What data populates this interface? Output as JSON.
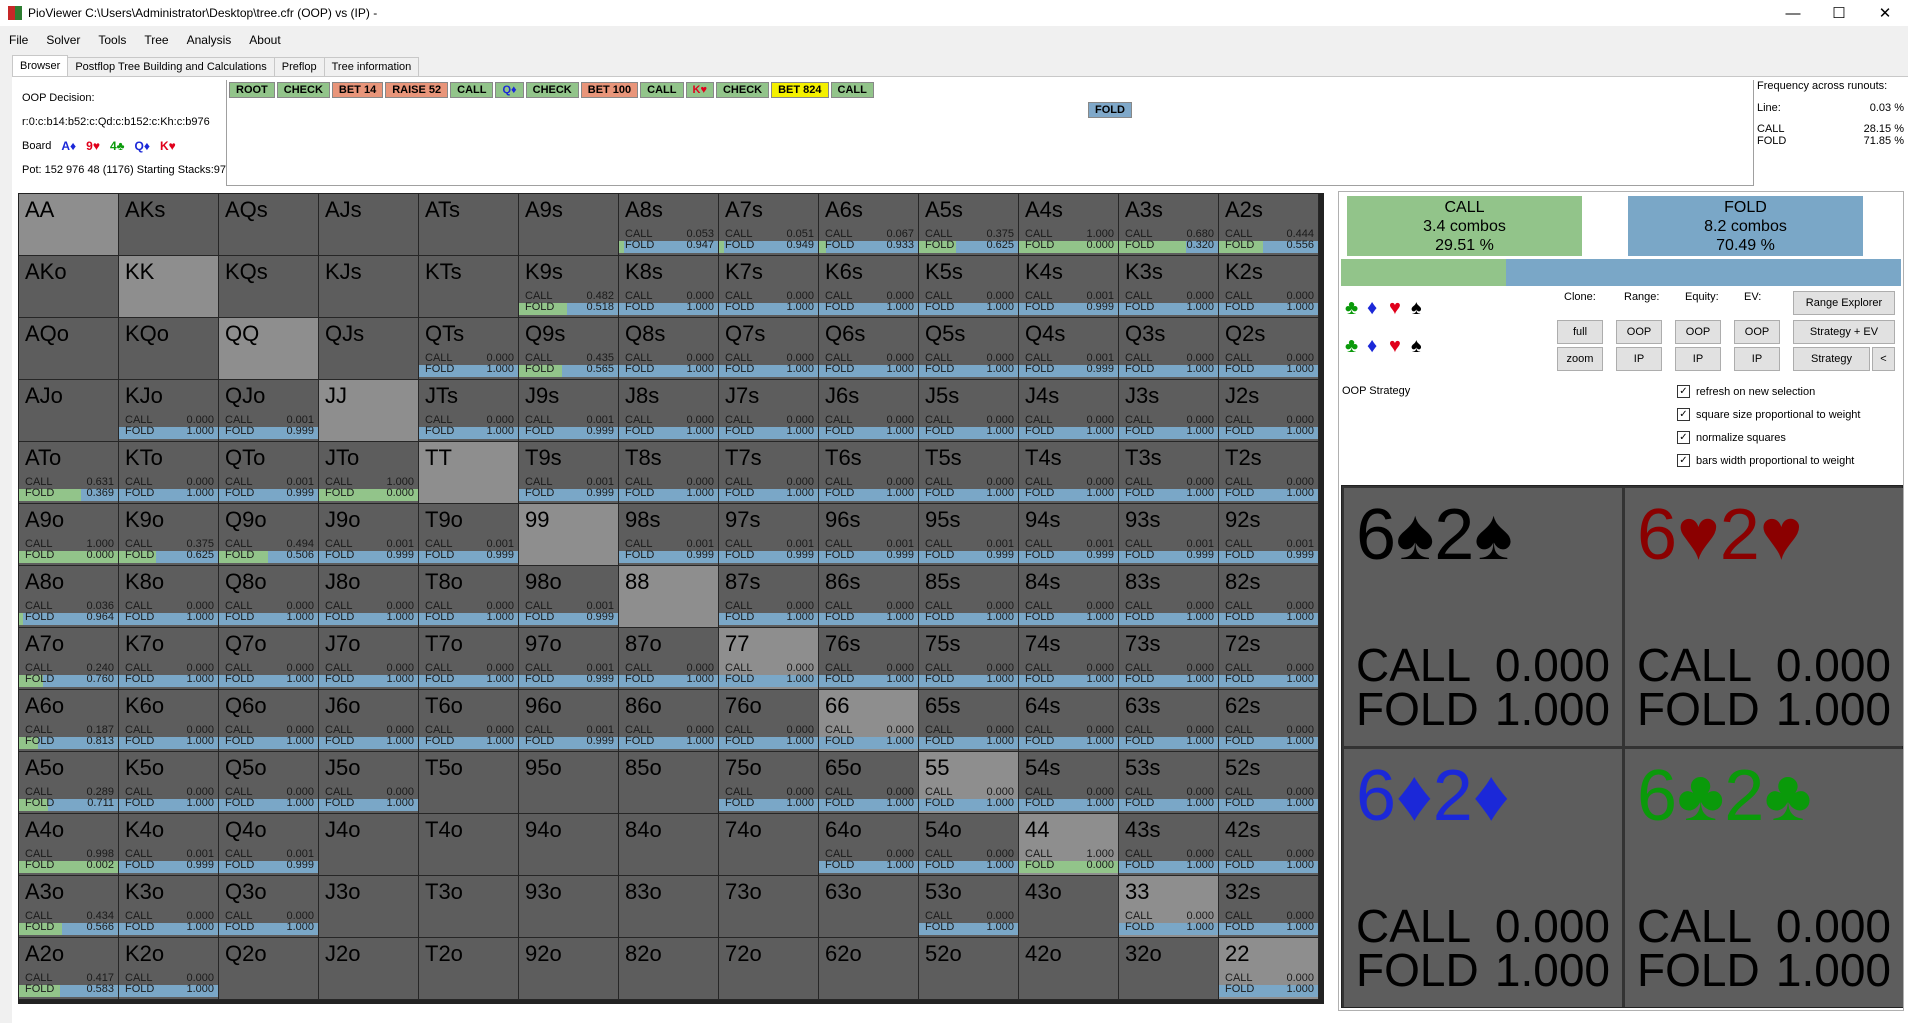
{
  "window": {
    "title": "PioViewer C:\\Users\\Administrator\\Desktop\\tree.cfr (OOP) vs (IP) -",
    "min": "—",
    "max": "☐",
    "close": "✕"
  },
  "menu": [
    "File",
    "Solver",
    "Tools",
    "Tree",
    "Analysis",
    "About"
  ],
  "tabs": [
    "Browser",
    "Postflop Tree Building and Calculations",
    "Preflop",
    "Tree information"
  ],
  "decision": {
    "title": "OOP Decision:",
    "line": "r:0:c:b14:b52:c:Qd:c:b152:c:Kh:c:b976",
    "board_label": "Board",
    "board": [
      {
        "t": "A♦",
        "c": "#1b28d8"
      },
      {
        "t": "9♥",
        "c": "#e0001b"
      },
      {
        "t": "4♣",
        "c": "#0a9a0a"
      },
      {
        "t": "Q♦",
        "c": "#1b28d8"
      },
      {
        "t": "K♥",
        "c": "#e0001b"
      }
    ],
    "pot": "Pot: 152 976 48 (1176) Starting Stacks:97"
  },
  "line": [
    {
      "t": "ROOT",
      "bg": "#92c48a"
    },
    {
      "t": "CHECK",
      "bg": "#92c48a"
    },
    {
      "t": "BET 14",
      "bg": "#e8957a"
    },
    {
      "t": "RAISE 52",
      "bg": "#e8957a"
    },
    {
      "t": "CALL",
      "bg": "#92c48a"
    },
    {
      "t": "Q♦",
      "bg": "#92c48a",
      "fg": "#1b28d8"
    },
    {
      "t": "CHECK",
      "bg": "#92c48a"
    },
    {
      "t": "BET 100",
      "bg": "#e8957a"
    },
    {
      "t": "CALL",
      "bg": "#92c48a"
    },
    {
      "t": "K♥",
      "bg": "#92c48a",
      "fg": "#e0001b"
    },
    {
      "t": "CHECK",
      "bg": "#92c48a"
    },
    {
      "t": "BET 824",
      "bg": "#f4f000"
    },
    {
      "t": "CALL",
      "bg": "#92c48a"
    }
  ],
  "fold_node": "FOLD",
  "frequency": {
    "title": "Frequency across runouts:",
    "line_label": "Line:",
    "line_val": "0.03 %",
    "call_label": "CALL",
    "call_val": "28.15 %",
    "fold_label": "FOLD",
    "fold_val": "71.85 %"
  },
  "summary": {
    "call": {
      "label": "CALL",
      "combos": "3.4 combos",
      "pct": "29.51 %",
      "frac": 0.2951,
      "color": "#92c48a"
    },
    "fold": {
      "label": "FOLD",
      "combos": "8.2 combos",
      "pct": "70.49 %",
      "color": "#7aa7c7"
    }
  },
  "clone": {
    "clone": "Clone:",
    "range": "Range:",
    "equity": "Equity:",
    "ev": "EV:"
  },
  "buttons": {
    "full": "full",
    "zoom": "zoom",
    "oop1": "OOP",
    "ip1": "IP",
    "oop2": "OOP",
    "ip2": "IP",
    "oop3": "OOP",
    "ip3": "IP",
    "range_explorer": "Range Explorer",
    "strategy_ev": "Strategy + EV",
    "strategy": "Strategy",
    "back": "<"
  },
  "suits": [
    {
      "t": "♣",
      "c": "#0a9a0a"
    },
    {
      "t": "♦",
      "c": "#1b28d8"
    },
    {
      "t": "♥",
      "c": "#e0001b"
    },
    {
      "t": "♠",
      "c": "#000"
    }
  ],
  "strategy_label": "OOP Strategy",
  "checks": [
    "refresh on new selection",
    "square size proportional to weight",
    "normalize squares",
    "bars width proportional to weight"
  ],
  "check_mark": "✓",
  "combos": [
    {
      "name": "6♠2♠",
      "color": "#000",
      "call": "0.000",
      "fold": "1.000"
    },
    {
      "name": "6♥2♥",
      "color": "#8b0000",
      "call": "0.000",
      "fold": "1.000"
    },
    {
      "name": "6♦2♦",
      "color": "#1b28d8",
      "call": "0.000",
      "fold": "1.000"
    },
    {
      "name": "6♣2♣",
      "color": "#0a9a0a",
      "call": "0.000",
      "fold": "1.000"
    }
  ],
  "combo_labels": {
    "call": "CALL",
    "fold": "FOLD"
  },
  "grid_labels": {
    "call": "CALL",
    "fold": "FOLD"
  },
  "grid": [
    [
      [
        "AA"
      ],
      [
        "AKs"
      ],
      [
        "AQs"
      ],
      [
        "AJs"
      ],
      [
        "ATs"
      ],
      [
        "A9s"
      ],
      [
        "A8s",
        "0.053",
        "0.947"
      ],
      [
        "A7s",
        "0.051",
        "0.949"
      ],
      [
        "A6s",
        "0.067",
        "0.933"
      ],
      [
        "A5s",
        "0.375",
        "0.625"
      ],
      [
        "A4s",
        "1.000",
        "0.000"
      ],
      [
        "A3s",
        "0.680",
        "0.320"
      ],
      [
        "A2s",
        "0.444",
        "0.556"
      ]
    ],
    [
      [
        "AKo"
      ],
      [
        "KK"
      ],
      [
        "KQs"
      ],
      [
        "KJs"
      ],
      [
        "KTs"
      ],
      [
        "K9s",
        "0.482",
        "0.518"
      ],
      [
        "K8s",
        "0.000",
        "1.000"
      ],
      [
        "K7s",
        "0.000",
        "1.000"
      ],
      [
        "K6s",
        "0.000",
        "1.000"
      ],
      [
        "K5s",
        "0.000",
        "1.000"
      ],
      [
        "K4s",
        "0.001",
        "0.999"
      ],
      [
        "K3s",
        "0.000",
        "1.000"
      ],
      [
        "K2s",
        "0.000",
        "1.000"
      ]
    ],
    [
      [
        "AQo"
      ],
      [
        "KQo"
      ],
      [
        "QQ"
      ],
      [
        "QJs"
      ],
      [
        "QTs",
        "0.000",
        "1.000"
      ],
      [
        "Q9s",
        "0.435",
        "0.565"
      ],
      [
        "Q8s",
        "0.000",
        "1.000"
      ],
      [
        "Q7s",
        "0.000",
        "1.000"
      ],
      [
        "Q6s",
        "0.000",
        "1.000"
      ],
      [
        "Q5s",
        "0.000",
        "1.000"
      ],
      [
        "Q4s",
        "0.001",
        "0.999"
      ],
      [
        "Q3s",
        "0.000",
        "1.000"
      ],
      [
        "Q2s",
        "0.000",
        "1.000"
      ]
    ],
    [
      [
        "AJo"
      ],
      [
        "KJo",
        "0.000",
        "1.000"
      ],
      [
        "QJo",
        "0.001",
        "0.999"
      ],
      [
        "JJ"
      ],
      [
        "JTs",
        "0.000",
        "1.000"
      ],
      [
        "J9s",
        "0.001",
        "0.999"
      ],
      [
        "J8s",
        "0.000",
        "1.000"
      ],
      [
        "J7s",
        "0.000",
        "1.000"
      ],
      [
        "J6s",
        "0.000",
        "1.000"
      ],
      [
        "J5s",
        "0.000",
        "1.000"
      ],
      [
        "J4s",
        "0.000",
        "1.000"
      ],
      [
        "J3s",
        "0.000",
        "1.000"
      ],
      [
        "J2s",
        "0.000",
        "1.000"
      ]
    ],
    [
      [
        "ATo",
        "0.631",
        "0.369"
      ],
      [
        "KTo",
        "0.000",
        "1.000"
      ],
      [
        "QTo",
        "0.001",
        "0.999"
      ],
      [
        "JTo",
        "1.000",
        "0.000"
      ],
      [
        "TT"
      ],
      [
        "T9s",
        "0.001",
        "0.999"
      ],
      [
        "T8s",
        "0.000",
        "1.000"
      ],
      [
        "T7s",
        "0.000",
        "1.000"
      ],
      [
        "T6s",
        "0.000",
        "1.000"
      ],
      [
        "T5s",
        "0.000",
        "1.000"
      ],
      [
        "T4s",
        "0.000",
        "1.000"
      ],
      [
        "T3s",
        "0.000",
        "1.000"
      ],
      [
        "T2s",
        "0.000",
        "1.000"
      ]
    ],
    [
      [
        "A9o",
        "1.000",
        "0.000"
      ],
      [
        "K9o",
        "0.375",
        "0.625"
      ],
      [
        "Q9o",
        "0.494",
        "0.506"
      ],
      [
        "J9o",
        "0.001",
        "0.999"
      ],
      [
        "T9o",
        "0.001",
        "0.999"
      ],
      [
        "99"
      ],
      [
        "98s",
        "0.001",
        "0.999"
      ],
      [
        "97s",
        "0.001",
        "0.999"
      ],
      [
        "96s",
        "0.001",
        "0.999"
      ],
      [
        "95s",
        "0.001",
        "0.999"
      ],
      [
        "94s",
        "0.001",
        "0.999"
      ],
      [
        "93s",
        "0.001",
        "0.999"
      ],
      [
        "92s",
        "0.001",
        "0.999"
      ]
    ],
    [
      [
        "A8o",
        "0.036",
        "0.964"
      ],
      [
        "K8o",
        "0.000",
        "1.000"
      ],
      [
        "Q8o",
        "0.000",
        "1.000"
      ],
      [
        "J8o",
        "0.000",
        "1.000"
      ],
      [
        "T8o",
        "0.000",
        "1.000"
      ],
      [
        "98o",
        "0.001",
        "0.999"
      ],
      [
        "88"
      ],
      [
        "87s",
        "0.000",
        "1.000"
      ],
      [
        "86s",
        "0.000",
        "1.000"
      ],
      [
        "85s",
        "0.000",
        "1.000"
      ],
      [
        "84s",
        "0.000",
        "1.000"
      ],
      [
        "83s",
        "0.000",
        "1.000"
      ],
      [
        "82s",
        "0.000",
        "1.000"
      ]
    ],
    [
      [
        "A7o",
        "0.240",
        "0.760"
      ],
      [
        "K7o",
        "0.000",
        "1.000"
      ],
      [
        "Q7o",
        "0.000",
        "1.000"
      ],
      [
        "J7o",
        "0.000",
        "1.000"
      ],
      [
        "T7o",
        "0.000",
        "1.000"
      ],
      [
        "97o",
        "0.001",
        "0.999"
      ],
      [
        "87o",
        "0.000",
        "1.000"
      ],
      [
        "77",
        "0.000",
        "1.000"
      ],
      [
        "76s",
        "0.000",
        "1.000"
      ],
      [
        "75s",
        "0.000",
        "1.000"
      ],
      [
        "74s",
        "0.000",
        "1.000"
      ],
      [
        "73s",
        "0.000",
        "1.000"
      ],
      [
        "72s",
        "0.000",
        "1.000"
      ]
    ],
    [
      [
        "A6o",
        "0.187",
        "0.813"
      ],
      [
        "K6o",
        "0.000",
        "1.000"
      ],
      [
        "Q6o",
        "0.000",
        "1.000"
      ],
      [
        "J6o",
        "0.000",
        "1.000"
      ],
      [
        "T6o",
        "0.000",
        "1.000"
      ],
      [
        "96o",
        "0.001",
        "0.999"
      ],
      [
        "86o",
        "0.000",
        "1.000"
      ],
      [
        "76o",
        "0.000",
        "1.000"
      ],
      [
        "66",
        "0.000",
        "1.000"
      ],
      [
        "65s",
        "0.000",
        "1.000"
      ],
      [
        "64s",
        "0.000",
        "1.000"
      ],
      [
        "63s",
        "0.000",
        "1.000"
      ],
      [
        "62s",
        "0.000",
        "1.000"
      ]
    ],
    [
      [
        "A5o",
        "0.289",
        "0.711"
      ],
      [
        "K5o",
        "0.000",
        "1.000"
      ],
      [
        "Q5o",
        "0.000",
        "1.000"
      ],
      [
        "J5o",
        "0.000",
        "1.000"
      ],
      [
        "T5o"
      ],
      [
        "95o"
      ],
      [
        "85o"
      ],
      [
        "75o",
        "0.000",
        "1.000"
      ],
      [
        "65o",
        "0.000",
        "1.000"
      ],
      [
        "55",
        "0.000",
        "1.000"
      ],
      [
        "54s",
        "0.000",
        "1.000"
      ],
      [
        "53s",
        "0.000",
        "1.000"
      ],
      [
        "52s",
        "0.000",
        "1.000"
      ]
    ],
    [
      [
        "A4o",
        "0.998",
        "0.002"
      ],
      [
        "K4o",
        "0.001",
        "0.999"
      ],
      [
        "Q4o",
        "0.001",
        "0.999"
      ],
      [
        "J4o"
      ],
      [
        "T4o"
      ],
      [
        "94o"
      ],
      [
        "84o"
      ],
      [
        "74o"
      ],
      [
        "64o",
        "0.000",
        "1.000"
      ],
      [
        "54o",
        "0.000",
        "1.000"
      ],
      [
        "44",
        "1.000",
        "0.000"
      ],
      [
        "43s",
        "0.000",
        "1.000"
      ],
      [
        "42s",
        "0.000",
        "1.000"
      ]
    ],
    [
      [
        "A3o",
        "0.434",
        "0.566"
      ],
      [
        "K3o",
        "0.000",
        "1.000"
      ],
      [
        "Q3o",
        "0.000",
        "1.000"
      ],
      [
        "J3o"
      ],
      [
        "T3o"
      ],
      [
        "93o"
      ],
      [
        "83o"
      ],
      [
        "73o"
      ],
      [
        "63o"
      ],
      [
        "53o",
        "0.000",
        "1.000"
      ],
      [
        "43o"
      ],
      [
        "33",
        "0.000",
        "1.000"
      ],
      [
        "32s",
        "0.000",
        "1.000"
      ]
    ],
    [
      [
        "A2o",
        "0.417",
        "0.583"
      ],
      [
        "K2o",
        "0.000",
        "1.000"
      ],
      [
        "Q2o"
      ],
      [
        "J2o"
      ],
      [
        "T2o"
      ],
      [
        "92o"
      ],
      [
        "82o"
      ],
      [
        "72o"
      ],
      [
        "62o"
      ],
      [
        "52o"
      ],
      [
        "42o"
      ],
      [
        "32o"
      ],
      [
        "22",
        "0.000",
        "1.000"
      ]
    ]
  ]
}
